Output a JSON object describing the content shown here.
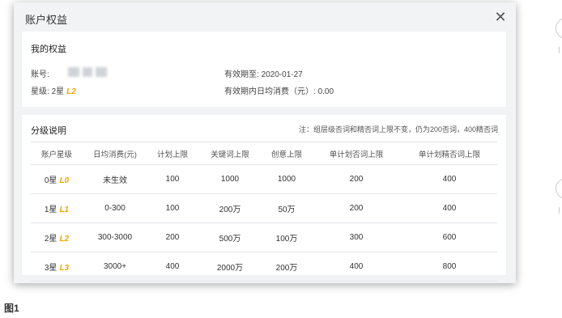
{
  "modal": {
    "title": "账户权益",
    "close": "✕"
  },
  "rights": {
    "title": "我的权益",
    "account_label": "账号:",
    "level_label": "星级: ",
    "level_value": "2星",
    "level_badge": "L2",
    "expiry_label": "有效期至: ",
    "expiry_value": "2020-01-27",
    "avg_spend_label": "有效期内日均消费（元）:",
    "avg_spend_value": "0.00"
  },
  "levels": {
    "title": "分级说明",
    "note": "注：组层级否词和精否词上限不变，仍为200否词，400精否词",
    "headers": [
      "账户星级",
      "日均消费(元)",
      "计划上限",
      "关键词上限",
      "创意上限",
      "单计划否词上限",
      "单计划精否词上限"
    ],
    "rows": [
      {
        "star": "0星",
        "badge": "L0",
        "spend": "未生效",
        "plan": "100",
        "keyword": "1000",
        "creative": "1000",
        "neg": "200",
        "exact_neg": "400"
      },
      {
        "star": "1星",
        "badge": "L1",
        "spend": "0-300",
        "plan": "100",
        "keyword": "200万",
        "creative": "50万",
        "neg": "200",
        "exact_neg": "400"
      },
      {
        "star": "2星",
        "badge": "L2",
        "spend": "300-3000",
        "plan": "200",
        "keyword": "500万",
        "creative": "100万",
        "neg": "300",
        "exact_neg": "600"
      },
      {
        "star": "3星",
        "badge": "L3",
        "spend": "3000+",
        "plan": "400",
        "keyword": "2000万",
        "creative": "200万",
        "neg": "400",
        "exact_neg": "800"
      }
    ]
  },
  "caption": "图1"
}
